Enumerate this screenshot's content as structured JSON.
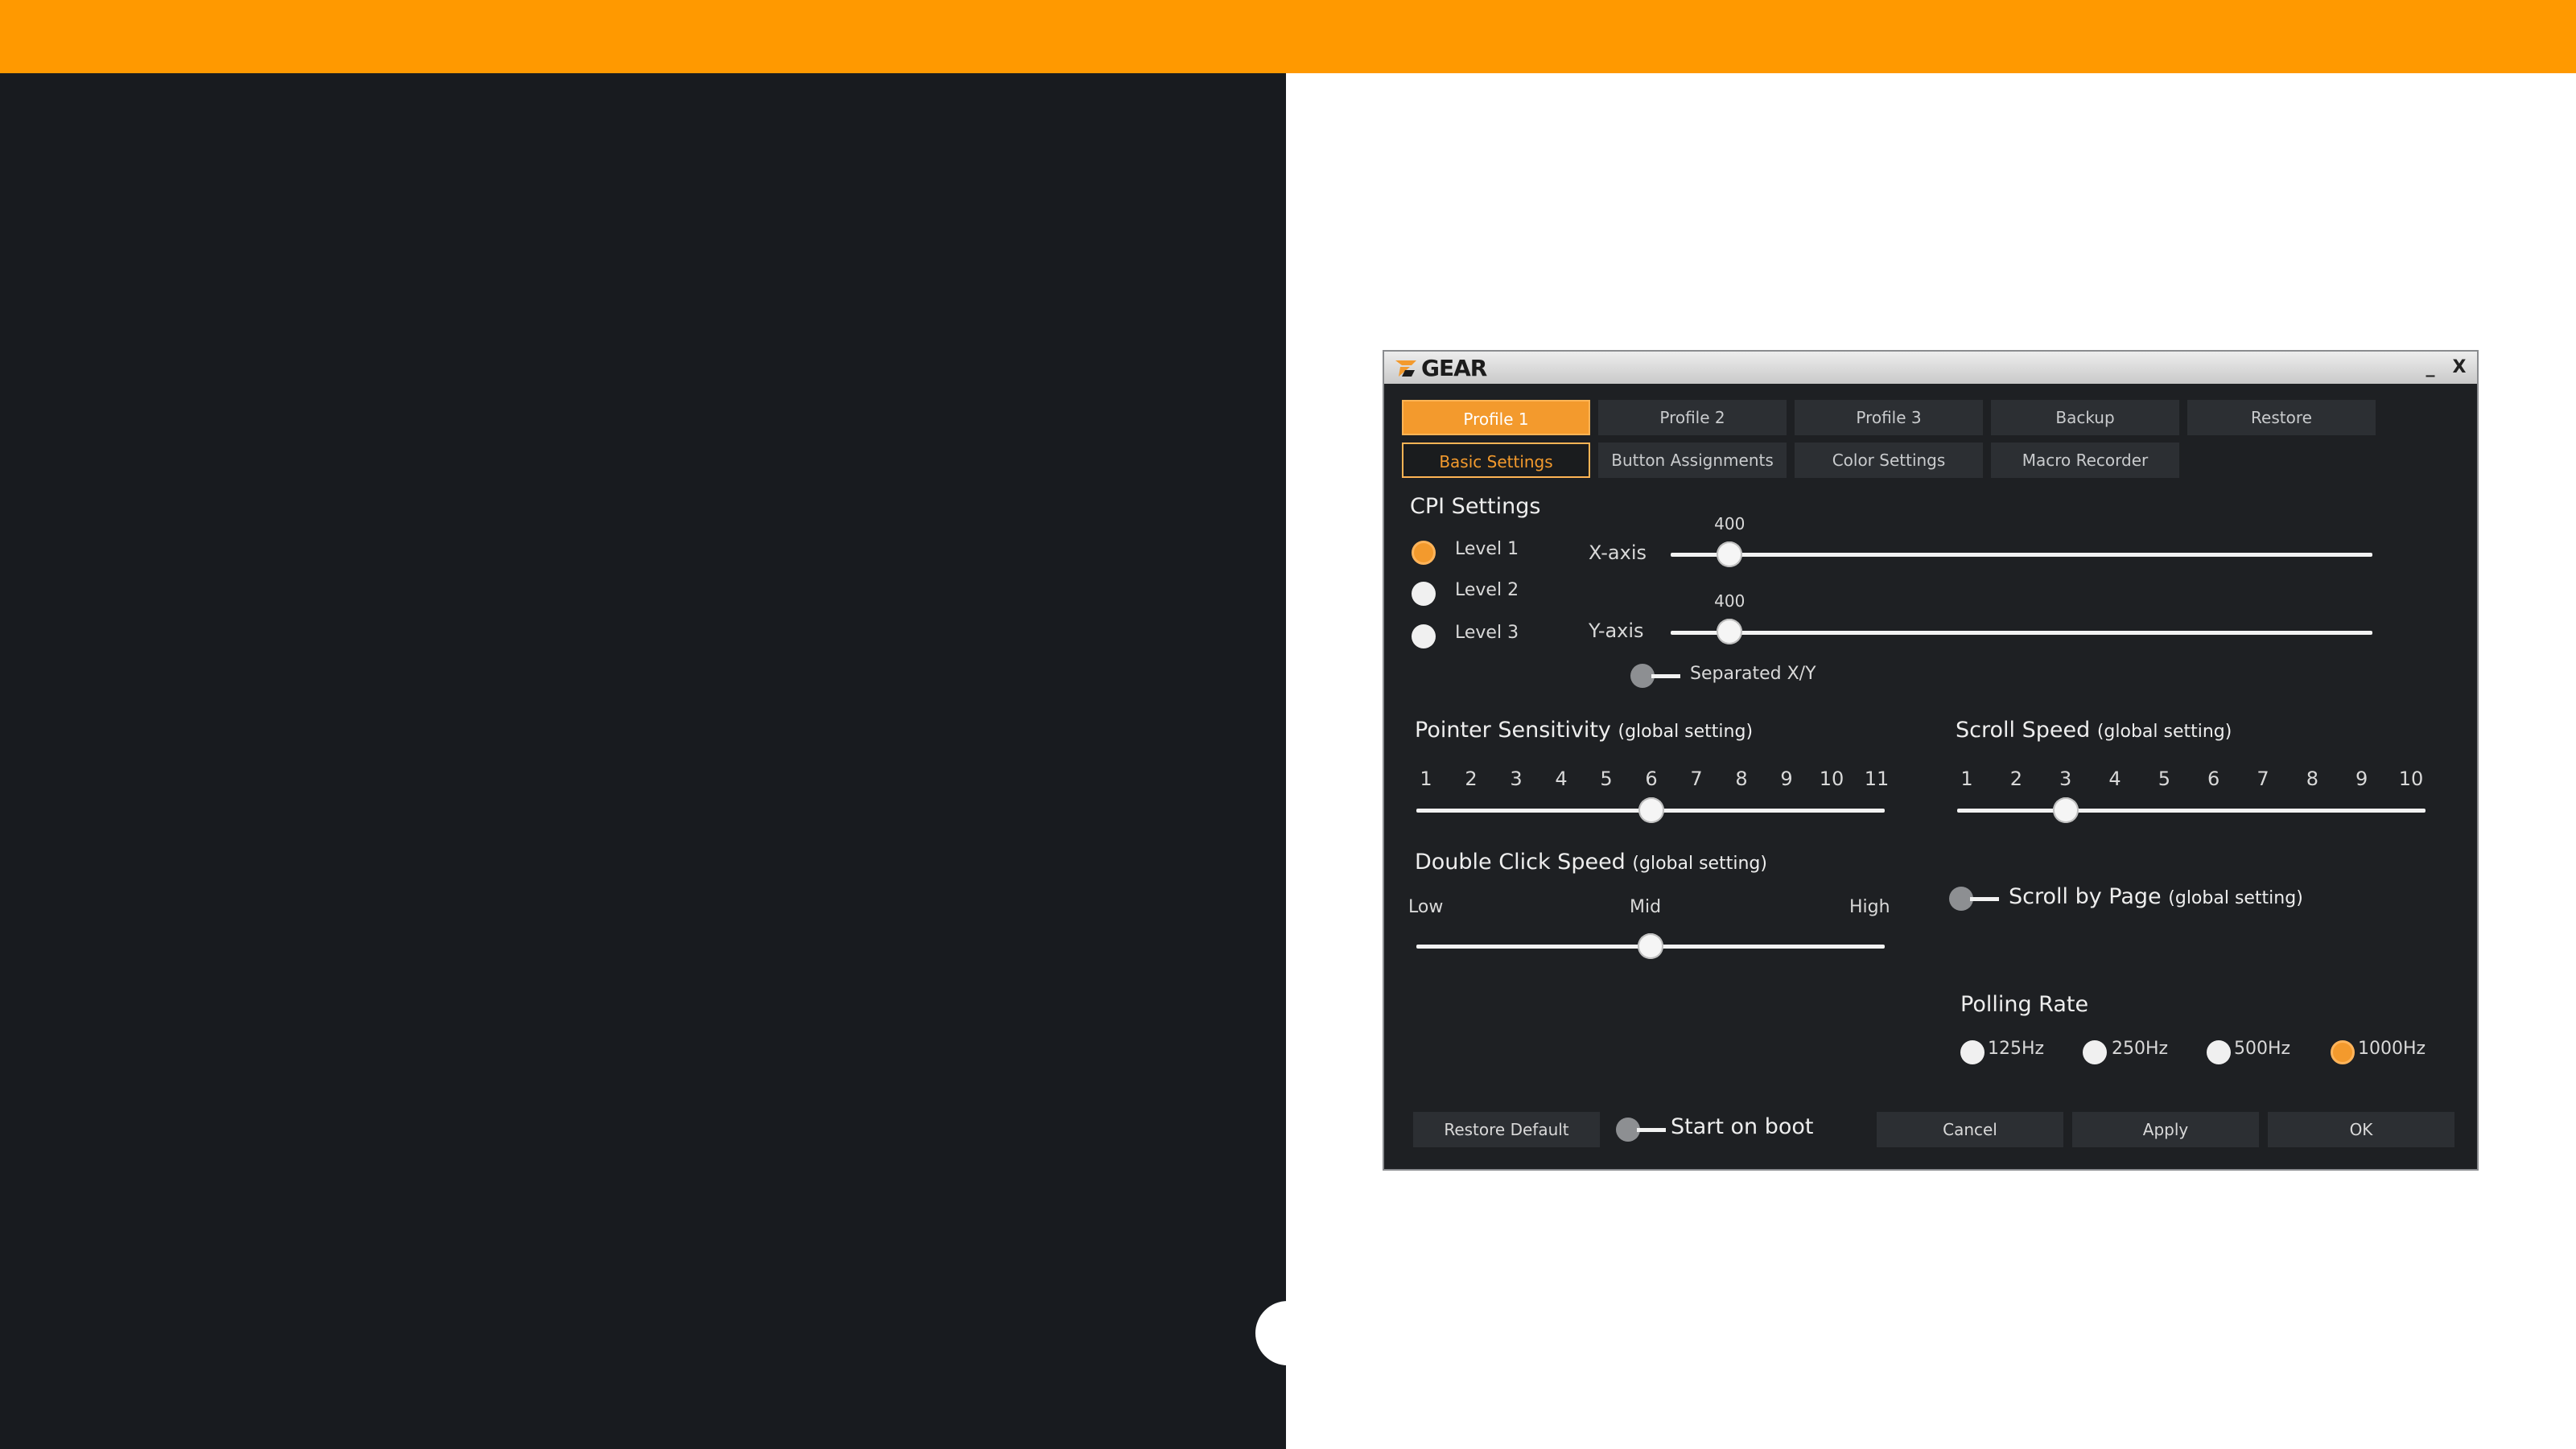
{
  "colors": {
    "accent": "#f39a2d",
    "topbar": "#ff9900",
    "dark": "#181b1f",
    "window": "#1e2023"
  },
  "window": {
    "brand": "GEAR",
    "minimize": "_",
    "close": "X"
  },
  "profile_tabs": [
    "Profile 1",
    "Profile 2",
    "Profile 3",
    "Backup",
    "Restore"
  ],
  "section_tabs": [
    "Basic Settings",
    "Button Assignments",
    "Color Settings",
    "Macro Recorder"
  ],
  "cpi": {
    "title": "CPI Settings",
    "levels": [
      "Level 1",
      "Level 2",
      "Level 3"
    ],
    "selected_level": 0,
    "x_axis": {
      "label": "X-axis",
      "value": "400",
      "fraction": 0.084
    },
    "y_axis": {
      "label": "Y-axis",
      "value": "400",
      "fraction": 0.084
    },
    "separated_label": "Separated X/Y"
  },
  "pointer": {
    "title": "Pointer Sensitivity",
    "note": "(global setting)",
    "ticks": [
      "1",
      "2",
      "3",
      "4",
      "5",
      "6",
      "7",
      "8",
      "9",
      "10",
      "11"
    ],
    "value": 6
  },
  "scroll": {
    "title": "Scroll Speed",
    "note": "(global setting)",
    "ticks": [
      "1",
      "2",
      "3",
      "4",
      "5",
      "6",
      "7",
      "8",
      "9",
      "10"
    ],
    "value": 3
  },
  "double_click": {
    "title": "Double Click Speed",
    "note": "(global setting)",
    "low": "Low",
    "mid": "Mid",
    "high": "High",
    "value": 0.5
  },
  "scroll_by_page": {
    "title": "Scroll by Page",
    "note": "(global setting)"
  },
  "polling": {
    "title": "Polling Rate",
    "options": [
      "125Hz",
      "250Hz",
      "500Hz",
      "1000Hz"
    ],
    "selected": 3
  },
  "footer": {
    "restore_default": "Restore Default",
    "start_on_boot": "Start on boot",
    "cancel": "Cancel",
    "apply": "Apply",
    "ok": "OK"
  }
}
